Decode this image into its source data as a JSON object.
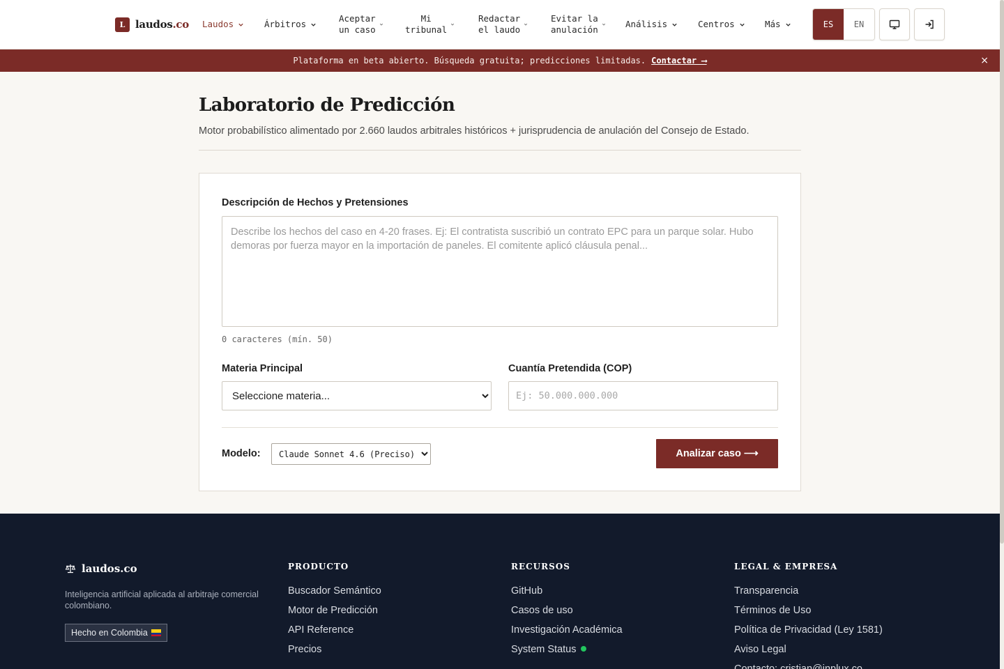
{
  "header": {
    "logo_letter": "L",
    "logo_name": "laudos",
    "logo_tld": ".co",
    "nav": [
      {
        "line1": "Laudos",
        "line2": ""
      },
      {
        "line1": "Árbitros",
        "line2": ""
      },
      {
        "line1": "Aceptar",
        "line2": "un caso"
      },
      {
        "line1": "Mi",
        "line2": "tribunal"
      },
      {
        "line1": "Redactar",
        "line2": "el laudo"
      },
      {
        "line1": "Evitar la",
        "line2": "anulación"
      },
      {
        "line1": "Análisis",
        "line2": ""
      },
      {
        "line1": "Centros",
        "line2": ""
      },
      {
        "line1": "Más",
        "line2": ""
      }
    ],
    "lang_es": "ES",
    "lang_en": "EN",
    "active_nav": "Laudos",
    "selected_lang": "ES"
  },
  "banner": {
    "text": "Plataforma en beta abierto. Búsqueda gratuita; predicciones limitadas.",
    "link": "Contactar ⟶",
    "close": "×"
  },
  "page": {
    "title": "Laboratorio de Predicción",
    "subtitle": "Motor probabilístico alimentado por 2.660 laudos arbitrales históricos + jurisprudencia de anulación del Consejo de Estado."
  },
  "form": {
    "facts_label": "Descripción de Hechos y Pretensiones",
    "facts_value": "",
    "facts_placeholder": "Describe los hechos del caso en 4-20 frases. Ej: El contratista suscribió un contrato EPC para un parque solar. Hubo demoras por fuerza mayor en la importación de paneles. El comitente aplicó cláusula penal...",
    "char_count": "0 caracteres (mín. 50)",
    "materia_label": "Materia Principal",
    "materia_selected": "Seleccione materia...",
    "cuantia_label": "Cuantía Pretendida (COP)",
    "cuantia_value": "",
    "cuantia_placeholder": "Ej: 50.000.000.000",
    "model_label": "Modelo:",
    "model_selected": "Claude Sonnet 4.6 (Preciso)",
    "submit_label": "Analizar caso ⟶"
  },
  "footer": {
    "brand": "laudos.co",
    "tagline": "Inteligencia artificial aplicada al arbitraje comercial colombiano.",
    "badge": "Hecho en Colombia",
    "producto": {
      "heading": "PRODUCTO",
      "links": [
        "Buscador Semántico",
        "Motor de Predicción",
        "API Reference",
        "Precios"
      ]
    },
    "recursos": {
      "heading": "RECURSOS",
      "links": [
        "GitHub",
        "Casos de uso",
        "Investigación Académica",
        "System Status"
      ]
    },
    "legal": {
      "heading": "LEGAL & EMPRESA",
      "links": [
        "Transparencia",
        "Términos de Uso",
        "Política de Privacidad (Ley 1581)",
        "Aviso Legal",
        "Contacto: cristian@inplux.co"
      ]
    }
  },
  "colors": {
    "brand": "#7b2b27",
    "footer_bg": "#121a2b",
    "page_bg": "#f9f7f3",
    "status_ok": "#22c55e"
  }
}
